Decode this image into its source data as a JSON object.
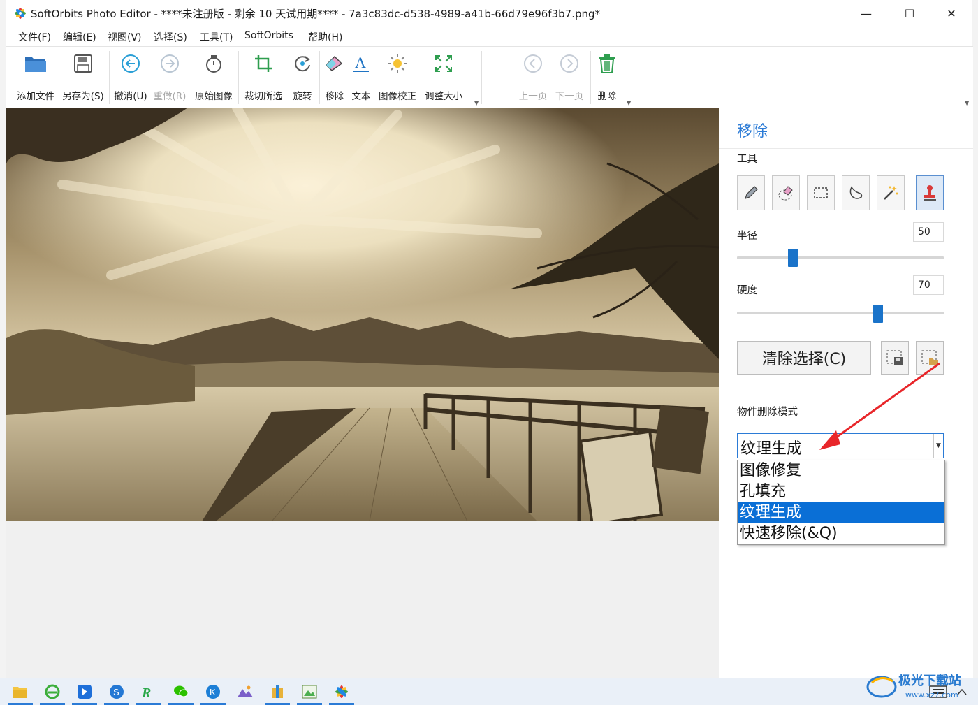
{
  "window": {
    "title": "SoftOrbits Photo Editor - ****未注册版 - 剩余 10 天试用期**** - 7a3c83dc-d538-4989-a41b-66d79e96f3b7.png*",
    "minimize": "—",
    "maximize": "☐",
    "close": "✕"
  },
  "menu": [
    "文件(F)",
    "编辑(E)",
    "视图(V)",
    "选择(S)",
    "工具(T)",
    "SoftOrbits",
    "帮助(H)"
  ],
  "ribbon": {
    "add_file": "添加文件",
    "save_as": "另存为(S)",
    "undo": "撤消(U)",
    "redo": "重做(R)",
    "original": "原始图像",
    "crop": "裁切所选",
    "rotate": "旋转",
    "remove": "移除",
    "text": "文本",
    "correct": "图像校正",
    "resize": "调整大小",
    "prev": "上一页",
    "next": "下一页",
    "delete": "删除"
  },
  "panel": {
    "title": "移除",
    "tools_label": "工具",
    "radius_label": "半径",
    "radius_value": "50",
    "radius_level": 0.26,
    "hardness_label": "硬度",
    "hardness_value": "70",
    "hardness_level": 0.69,
    "clear_selection": "清除选择(C)",
    "mode_label": "物件删除模式",
    "mode_selected": "纹理生成",
    "mode_options": [
      "图像修复",
      "孔填充",
      "纹理生成",
      "快速移除(&Q)"
    ]
  },
  "colors": {
    "accent": "#2b7bd6",
    "selection": "#0a6fd6",
    "arrow": "#e8262a"
  }
}
